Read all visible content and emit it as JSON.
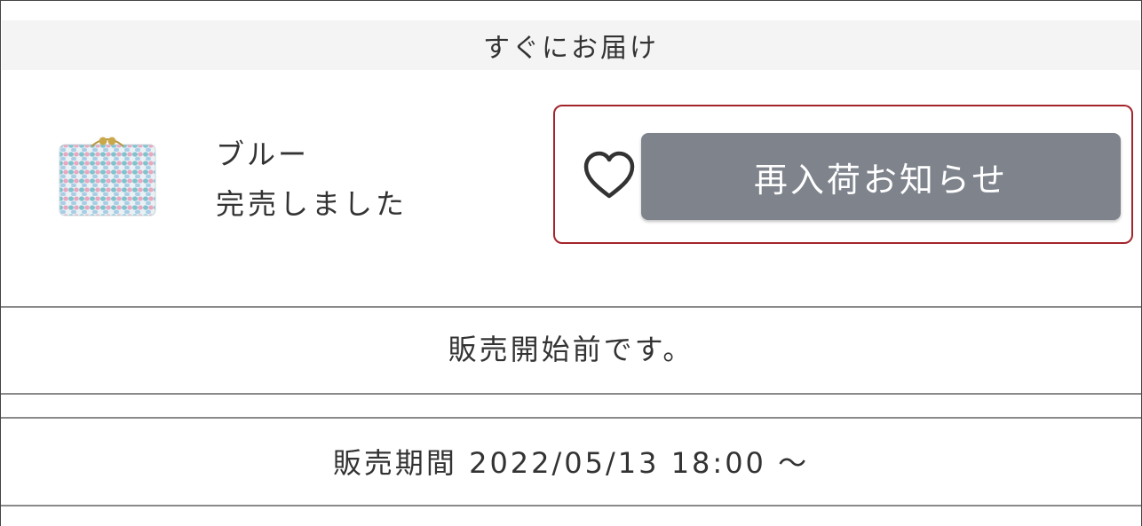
{
  "delivery": {
    "header": "すぐにお届け"
  },
  "variant": {
    "name": "ブルー",
    "status": "完売しました",
    "thumbnail_icon": "product-thumbnail-purse"
  },
  "actions": {
    "favorite_icon": "heart-icon",
    "restock_label": "再入荷お知らせ",
    "restock_color": "#7e838c",
    "highlight_color": "#a3252b"
  },
  "notice": {
    "before_sale": "販売開始前です。"
  },
  "sale_period": {
    "text": "販売期間 2022/05/13 18:00 〜"
  }
}
